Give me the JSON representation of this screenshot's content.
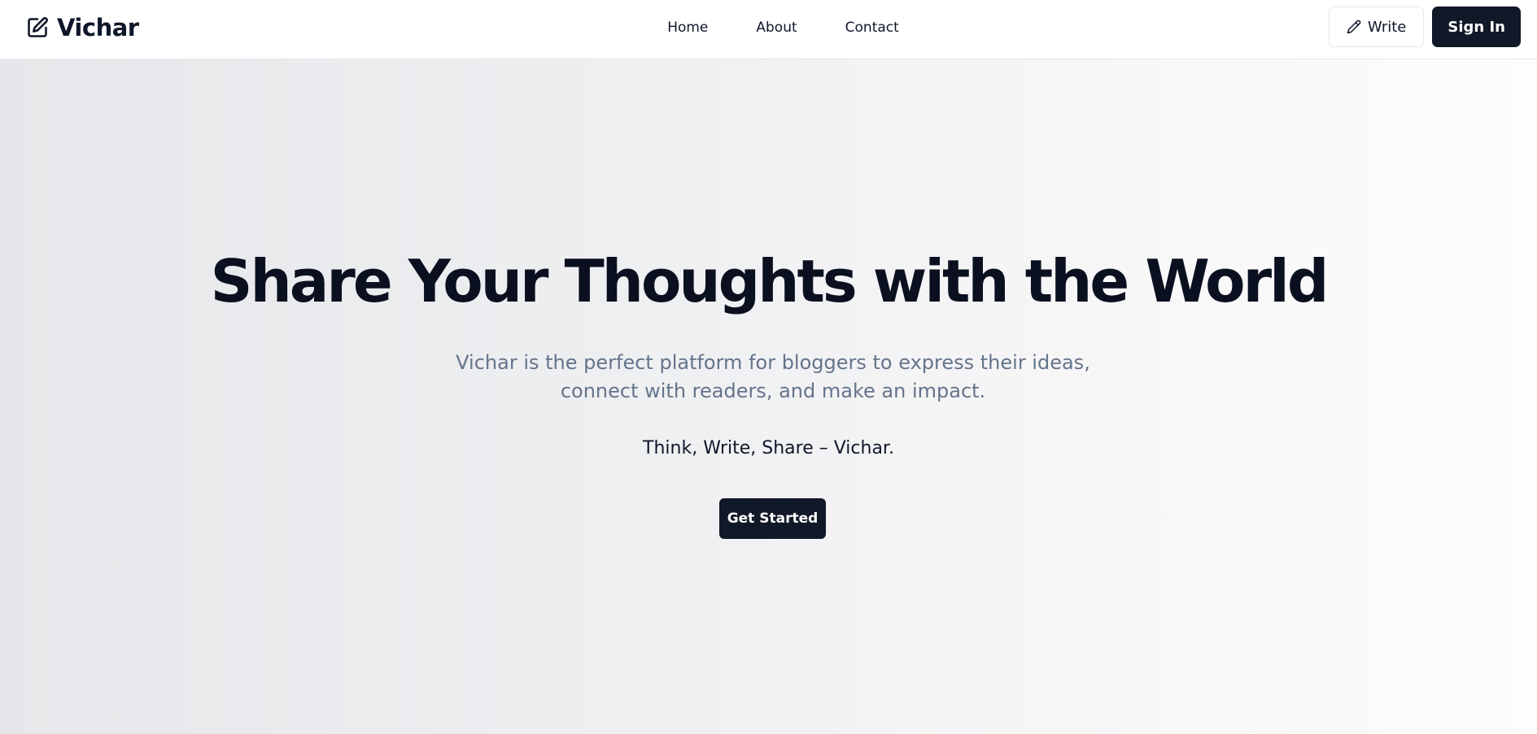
{
  "header": {
    "brand": {
      "icon": "edit-square-icon",
      "name": "Vichar"
    },
    "nav": [
      {
        "label": "Home"
      },
      {
        "label": "About"
      },
      {
        "label": "Contact"
      }
    ],
    "actions": {
      "write_icon": "pencil-icon",
      "write_label": "Write",
      "signin_label": "Sign In"
    }
  },
  "hero": {
    "title": "Share Your Thoughts with the World",
    "subtitle": "Vichar is the perfect platform for bloggers to express their ideas, connect with readers, and make an impact.",
    "tagline": "Think, Write, Share – Vichar.",
    "cta_label": "Get Started"
  },
  "colors": {
    "primary_dark": "#111827",
    "text_dark": "#0f172a",
    "muted_text": "#64748b",
    "background_gradient_start": "#e6e7ea",
    "background_gradient_end": "#fdfdfd"
  }
}
